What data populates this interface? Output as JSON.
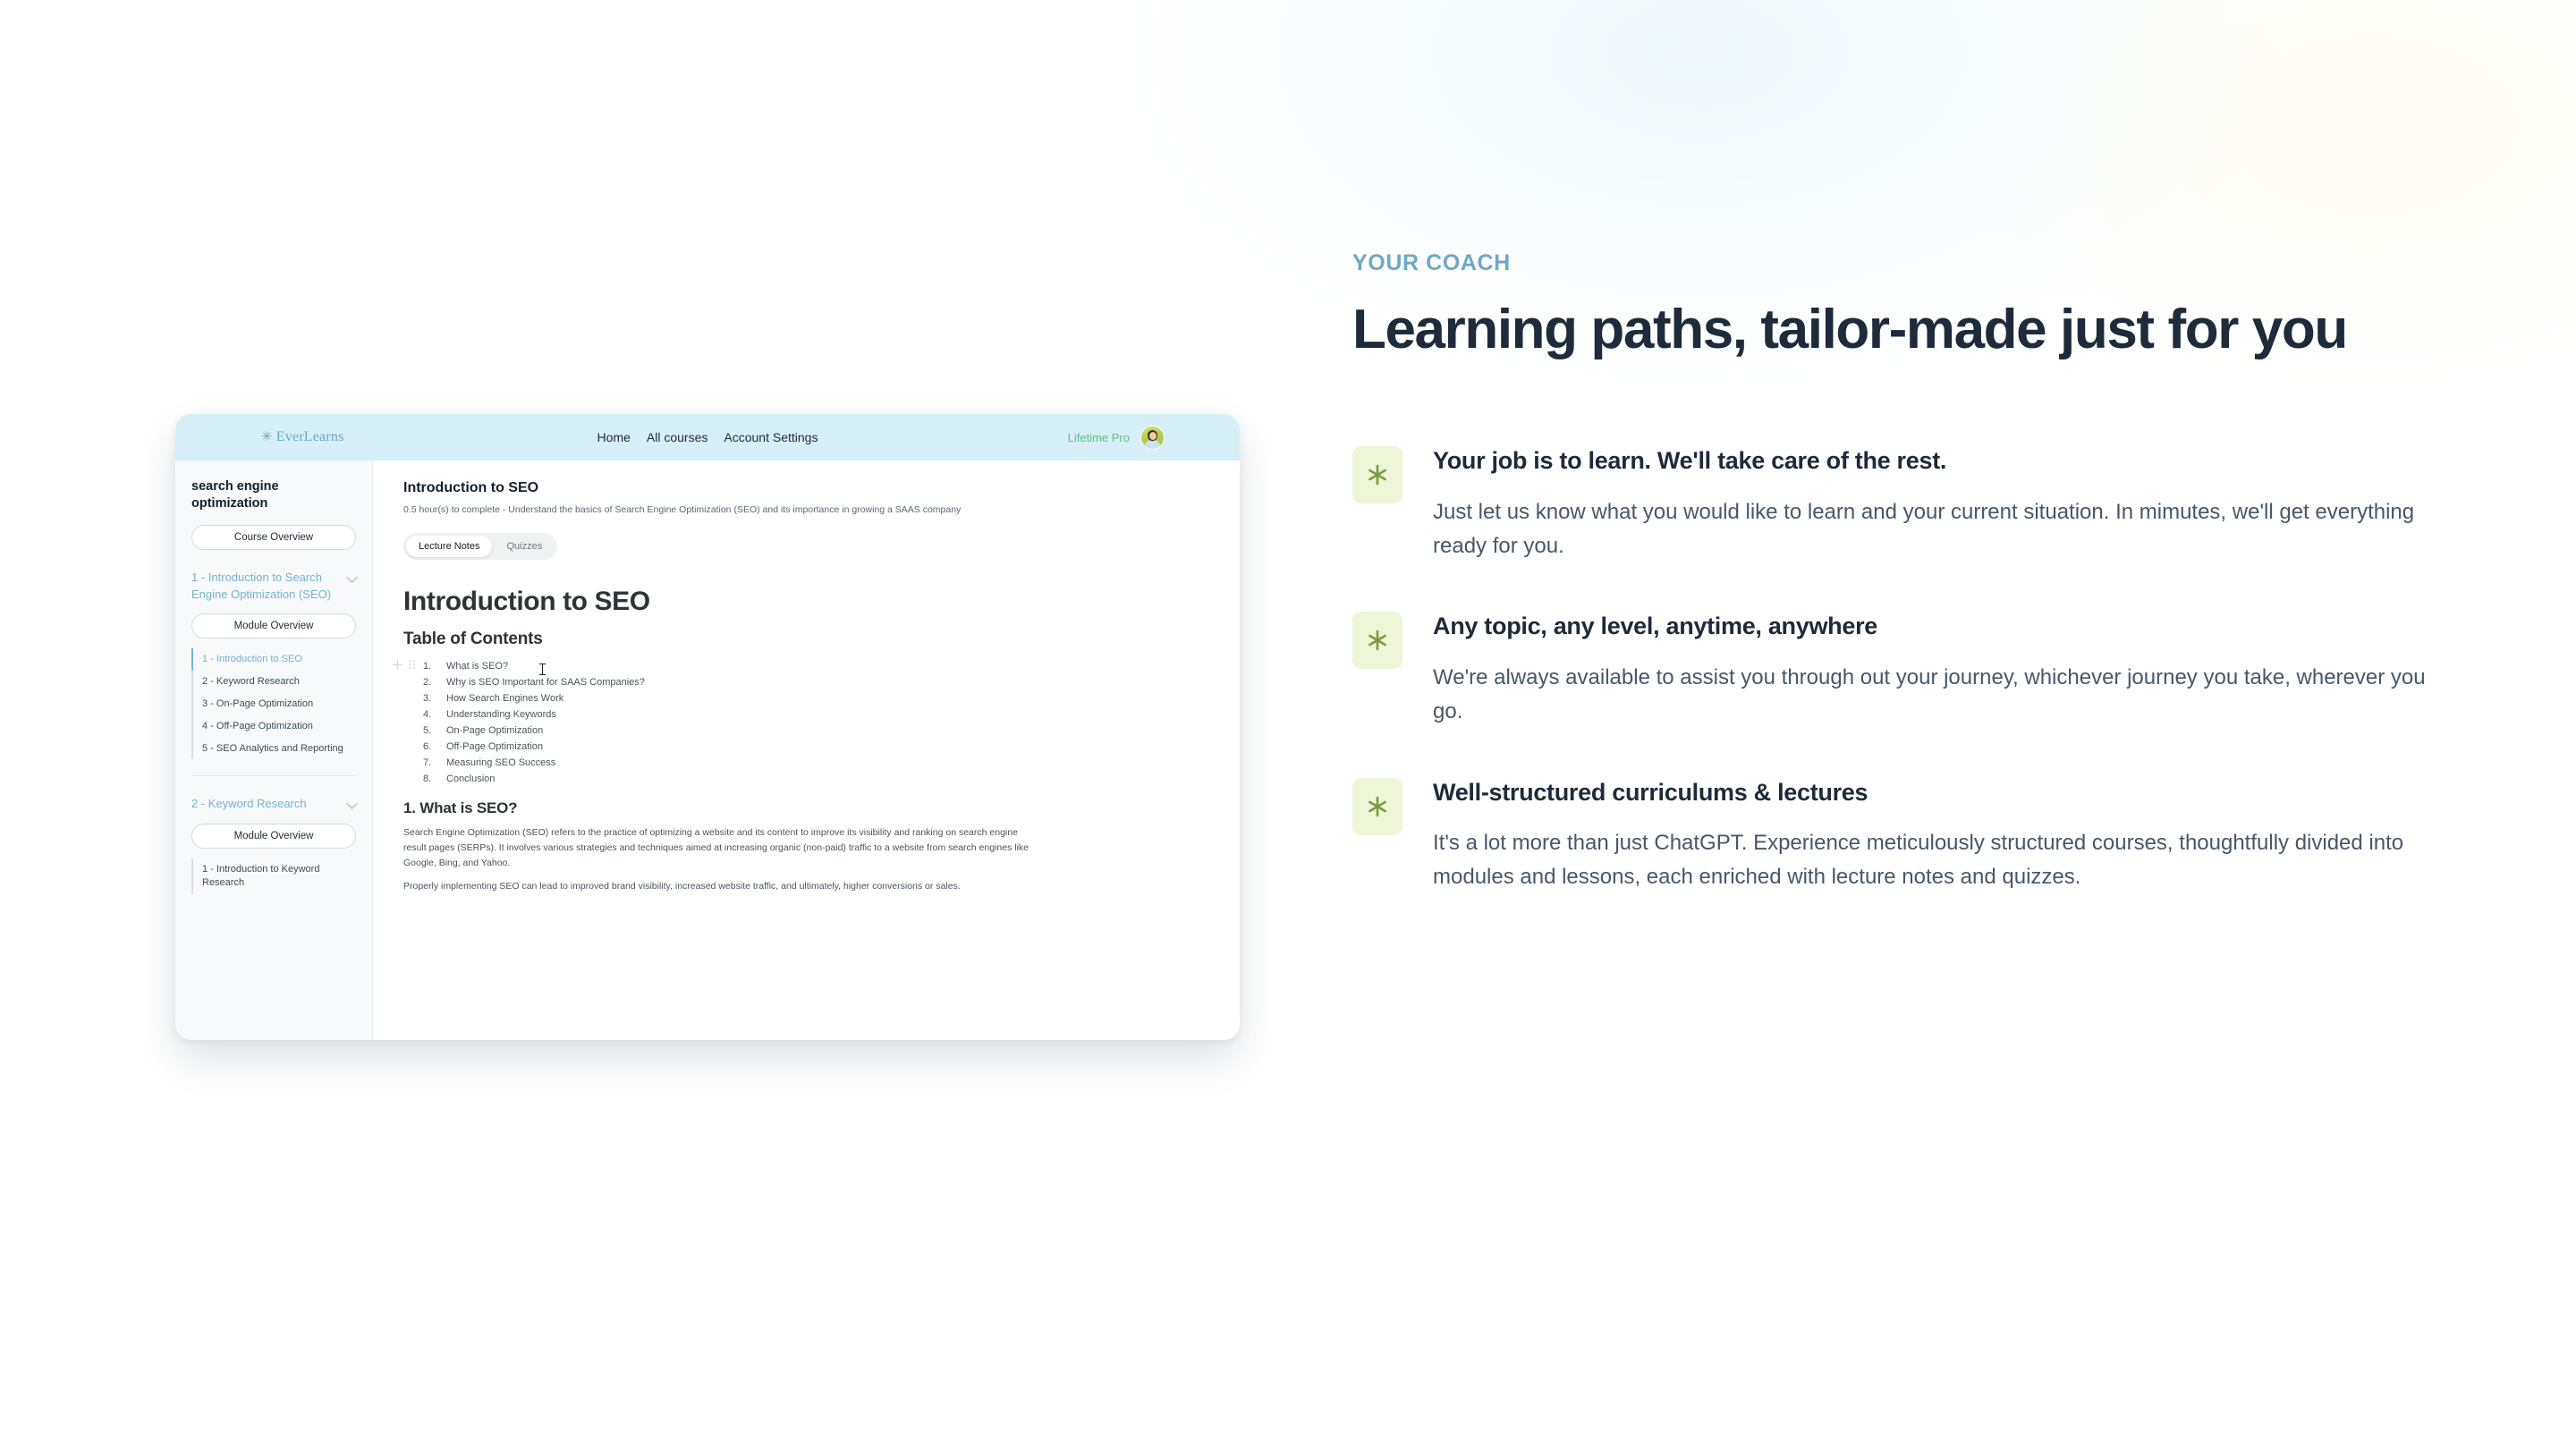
{
  "app": {
    "brand": {
      "mark": "✳",
      "name": "EverLearns"
    },
    "topnav": [
      "Home",
      "All courses",
      "Account Settings"
    ],
    "plan_badge": "Lifetime Pro",
    "sidebar": {
      "course_title": "search engine optimization",
      "course_overview_label": "Course Overview",
      "modules": [
        {
          "title": "1 - Introduction to Search Engine Optimization (SEO)",
          "overview_label": "Module Overview",
          "lessons": [
            "1 - Introduction to SEO",
            "2 - Keyword Research",
            "3 - On-Page Optimization",
            "4 - Off-Page Optimization",
            "5 - SEO Analytics and Reporting"
          ],
          "active_lesson_index": 0
        },
        {
          "title": "2 - Keyword Research",
          "overview_label": "Module Overview",
          "lessons": [
            "1 - Introduction to Keyword Research"
          ],
          "active_lesson_index": -1
        }
      ]
    },
    "main": {
      "lesson_title": "Introduction to SEO",
      "lesson_meta": "0.5 hour(s) to complete - Understand the basics of Search Engine Optimization (SEO) and its importance in growing a SAAS company",
      "tabs": [
        {
          "label": "Lecture Notes",
          "active": true
        },
        {
          "label": "Quizzes",
          "active": false
        }
      ],
      "doc": {
        "h1": "Introduction to SEO",
        "toc_heading": "Table of Contents",
        "toc": [
          {
            "num": "1.",
            "label": "What is SEO?"
          },
          {
            "num": "2.",
            "label": "Why is SEO Important for SAAS Companies?"
          },
          {
            "num": "3.",
            "label": "How Search Engines Work"
          },
          {
            "num": "4.",
            "label": "Understanding Keywords"
          },
          {
            "num": "5.",
            "label": "On-Page Optimization"
          },
          {
            "num": "6.",
            "label": "Off-Page Optimization"
          },
          {
            "num": "7.",
            "label": "Measuring SEO Success"
          },
          {
            "num": "8.",
            "label": "Conclusion"
          }
        ],
        "section_heading": "1. What is SEO?",
        "paragraph_1": "Search Engine Optimization (SEO) refers to the practice of optimizing a website and its content to improve its visibility and ranking on search engine result pages (SERPs). It involves various strategies and techniques aimed at increasing organic (non-paid) traffic to a website from search engines like Google, Bing, and Yahoo.",
        "paragraph_2": "Properly implementing SEO can lead to improved brand visibility, increased website traffic, and ultimately, higher conversions or sales."
      }
    }
  },
  "promo": {
    "eyebrow": "YOUR COACH",
    "heading": "Learning paths, tailor-made just for you",
    "features": [
      {
        "icon": "asterisk-icon",
        "title": "Your job is to learn. We'll take care of the rest.",
        "description": "Just let us know what you would like to learn and your current situation. In mimutes, we'll get everything ready for you."
      },
      {
        "icon": "asterisk-icon",
        "title": "Any topic, any level, anytime, anywhere",
        "description": "We're always available to assist you through out your journey, whichever journey you take, wherever you go."
      },
      {
        "icon": "asterisk-icon",
        "title": "Well-structured curriculums & lectures",
        "description": "It's a lot more than just ChatGPT. Experience meticulously structured courses, thoughtfully divided into modules and lessons, each enriched with lecture notes and quizzes."
      }
    ]
  },
  "colors": {
    "topbar": "#d6eff6",
    "brand": "#6aa9c4",
    "plan": "#5cc27f",
    "accent_blue": "#74b3cf",
    "eyebrow": "#6ea8c6",
    "heading": "#1d2b3a",
    "badge_bg": "#edf6d6",
    "badge_fg": "#7a9b42"
  }
}
